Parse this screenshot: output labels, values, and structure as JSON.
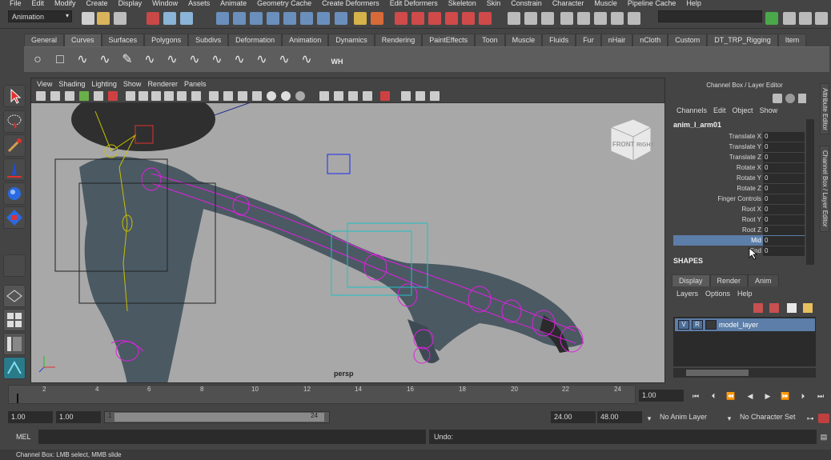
{
  "menubar": [
    "File",
    "Edit",
    "Modify",
    "Create",
    "Display",
    "Window",
    "Assets",
    "Animate",
    "Geometry Cache",
    "Create Deformers",
    "Edit Deformers",
    "Skeleton",
    "Skin",
    "Constrain",
    "Character",
    "Muscle",
    "Pipeline Cache",
    "Help"
  ],
  "status": {
    "mode": "Animation"
  },
  "shelf": {
    "tabs": [
      "General",
      "Curves",
      "Surfaces",
      "Polygons",
      "Subdivs",
      "Deformation",
      "Animation",
      "Dynamics",
      "Rendering",
      "PaintEffects",
      "Toon",
      "Muscle",
      "Fluids",
      "Fur",
      "nHair",
      "nCloth",
      "Custom",
      "DT_TRP_Rigging",
      "Item"
    ],
    "active_tab": "Curves",
    "icons": [
      "circle-icon",
      "square-icon",
      "cv-curve-icon",
      "ep-curve-icon",
      "pencil-curve-icon",
      "arc-icon",
      "curve-icon",
      "curve-icon",
      "curve-icon",
      "curve-icon",
      "curve-icon",
      "curve-icon",
      "curve-icon",
      "wh-icon"
    ],
    "wh_label": "WH"
  },
  "viewport": {
    "menu": [
      "View",
      "Shading",
      "Lighting",
      "Show",
      "Renderer",
      "Panels"
    ],
    "camera_label": "persp",
    "viewcube_front": "FRONT",
    "viewcube_right": "RIGHT"
  },
  "channel_box": {
    "title": "Channel Box / Layer Editor",
    "menu": [
      "Channels",
      "Edit",
      "Object",
      "Show"
    ],
    "object_name": "anim_l_arm01",
    "attributes": [
      {
        "name": "Translate X",
        "value": "0"
      },
      {
        "name": "Translate Y",
        "value": "0"
      },
      {
        "name": "Translate Z",
        "value": "0"
      },
      {
        "name": "Rotate X",
        "value": "0"
      },
      {
        "name": "Rotate Y",
        "value": "0"
      },
      {
        "name": "Rotate Z",
        "value": "0"
      },
      {
        "name": "Finger Controls",
        "value": "0"
      },
      {
        "name": "Root X",
        "value": "0"
      },
      {
        "name": "Root Y",
        "value": "0"
      },
      {
        "name": "Root Z",
        "value": "0"
      },
      {
        "name": "Mid",
        "value": "0"
      },
      {
        "name": "End",
        "value": "0"
      }
    ],
    "selected_attribute": "Mid",
    "shapes_label": "SHAPES"
  },
  "layer_editor": {
    "tabs": [
      "Display",
      "Render",
      "Anim"
    ],
    "active_tab": "Display",
    "menu": [
      "Layers",
      "Options",
      "Help"
    ],
    "layer": {
      "v": "V",
      "r": "R",
      "name": "model_layer"
    }
  },
  "side_tabs": [
    "Attribute Editor",
    "Channel Box / Layer Editor"
  ],
  "timeline": {
    "ticks": [
      "2",
      "4",
      "6",
      "8",
      "10",
      "12",
      "14",
      "16",
      "18",
      "20",
      "22",
      "24"
    ],
    "current_frame": "1.00"
  },
  "range": {
    "start": "1.00",
    "playback_start": "1.00",
    "slider_start": "1",
    "slider_end": "24",
    "playback_end": "24.00",
    "end": "48.00",
    "anim_layer": "No Anim Layer",
    "character_set": "No Character Set"
  },
  "command": {
    "mel_label": "MEL",
    "result": "Undo:"
  },
  "help_line": "Channel Box: LMB select, MMB slide",
  "colors": {
    "selection": "#5c7ea8",
    "wireframe": "#e020e0",
    "skin": "#4b5963"
  }
}
